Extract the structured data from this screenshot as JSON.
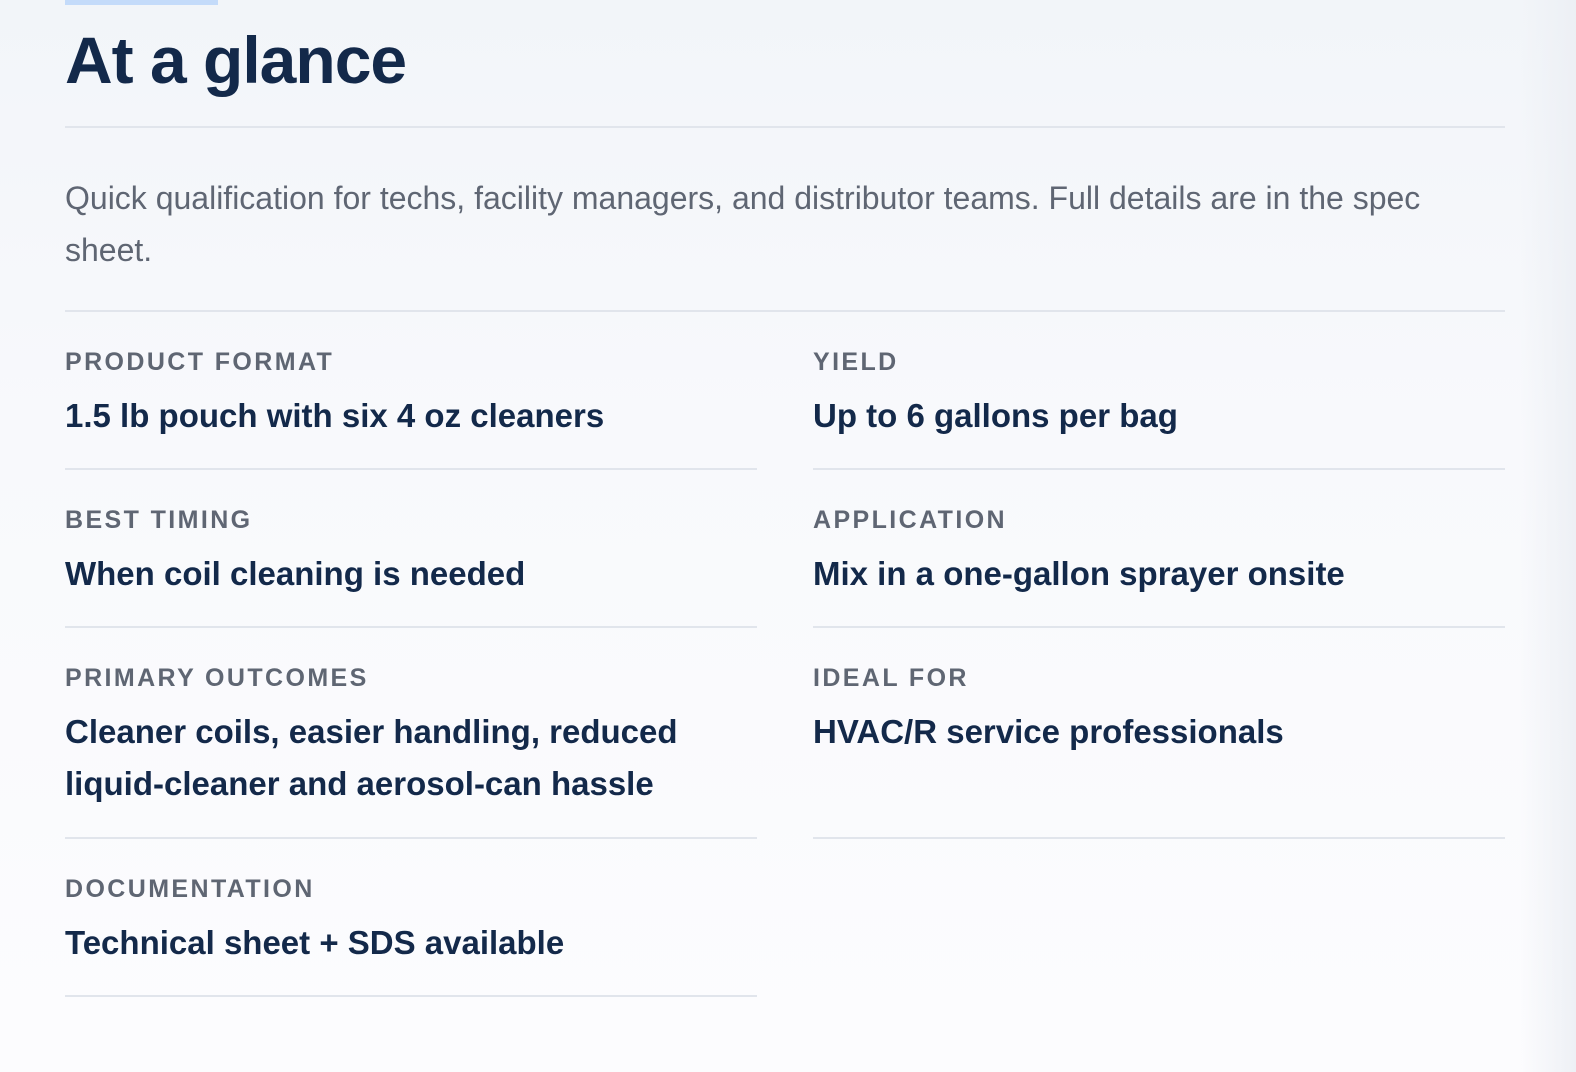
{
  "section": {
    "title": "At a glance",
    "intro": "Quick qualification for techs, facility managers, and distributor teams. Full details are in the spec sheet."
  },
  "specs": [
    {
      "label": "PRODUCT FORMAT",
      "value": "1.5 lb pouch with six 4 oz cleaners"
    },
    {
      "label": "YIELD",
      "value": "Up to 6 gallons per bag"
    },
    {
      "label": "BEST TIMING",
      "value": "When coil cleaning is needed"
    },
    {
      "label": "APPLICATION",
      "value": "Mix in a one-gallon sprayer onsite"
    },
    {
      "label": "PRIMARY OUTCOMES",
      "value": "Cleaner coils, easier handling, reduced liquid-cleaner and aerosol-can hassle"
    },
    {
      "label": "IDEAL FOR",
      "value": "HVAC/R service professionals"
    },
    {
      "label": "DOCUMENTATION",
      "value": "Technical sheet + SDS available"
    }
  ],
  "colors": {
    "heading": "#13294a",
    "muted": "#5f6673",
    "divider": "#e1e5ec",
    "accent": "#c4dbfa"
  }
}
